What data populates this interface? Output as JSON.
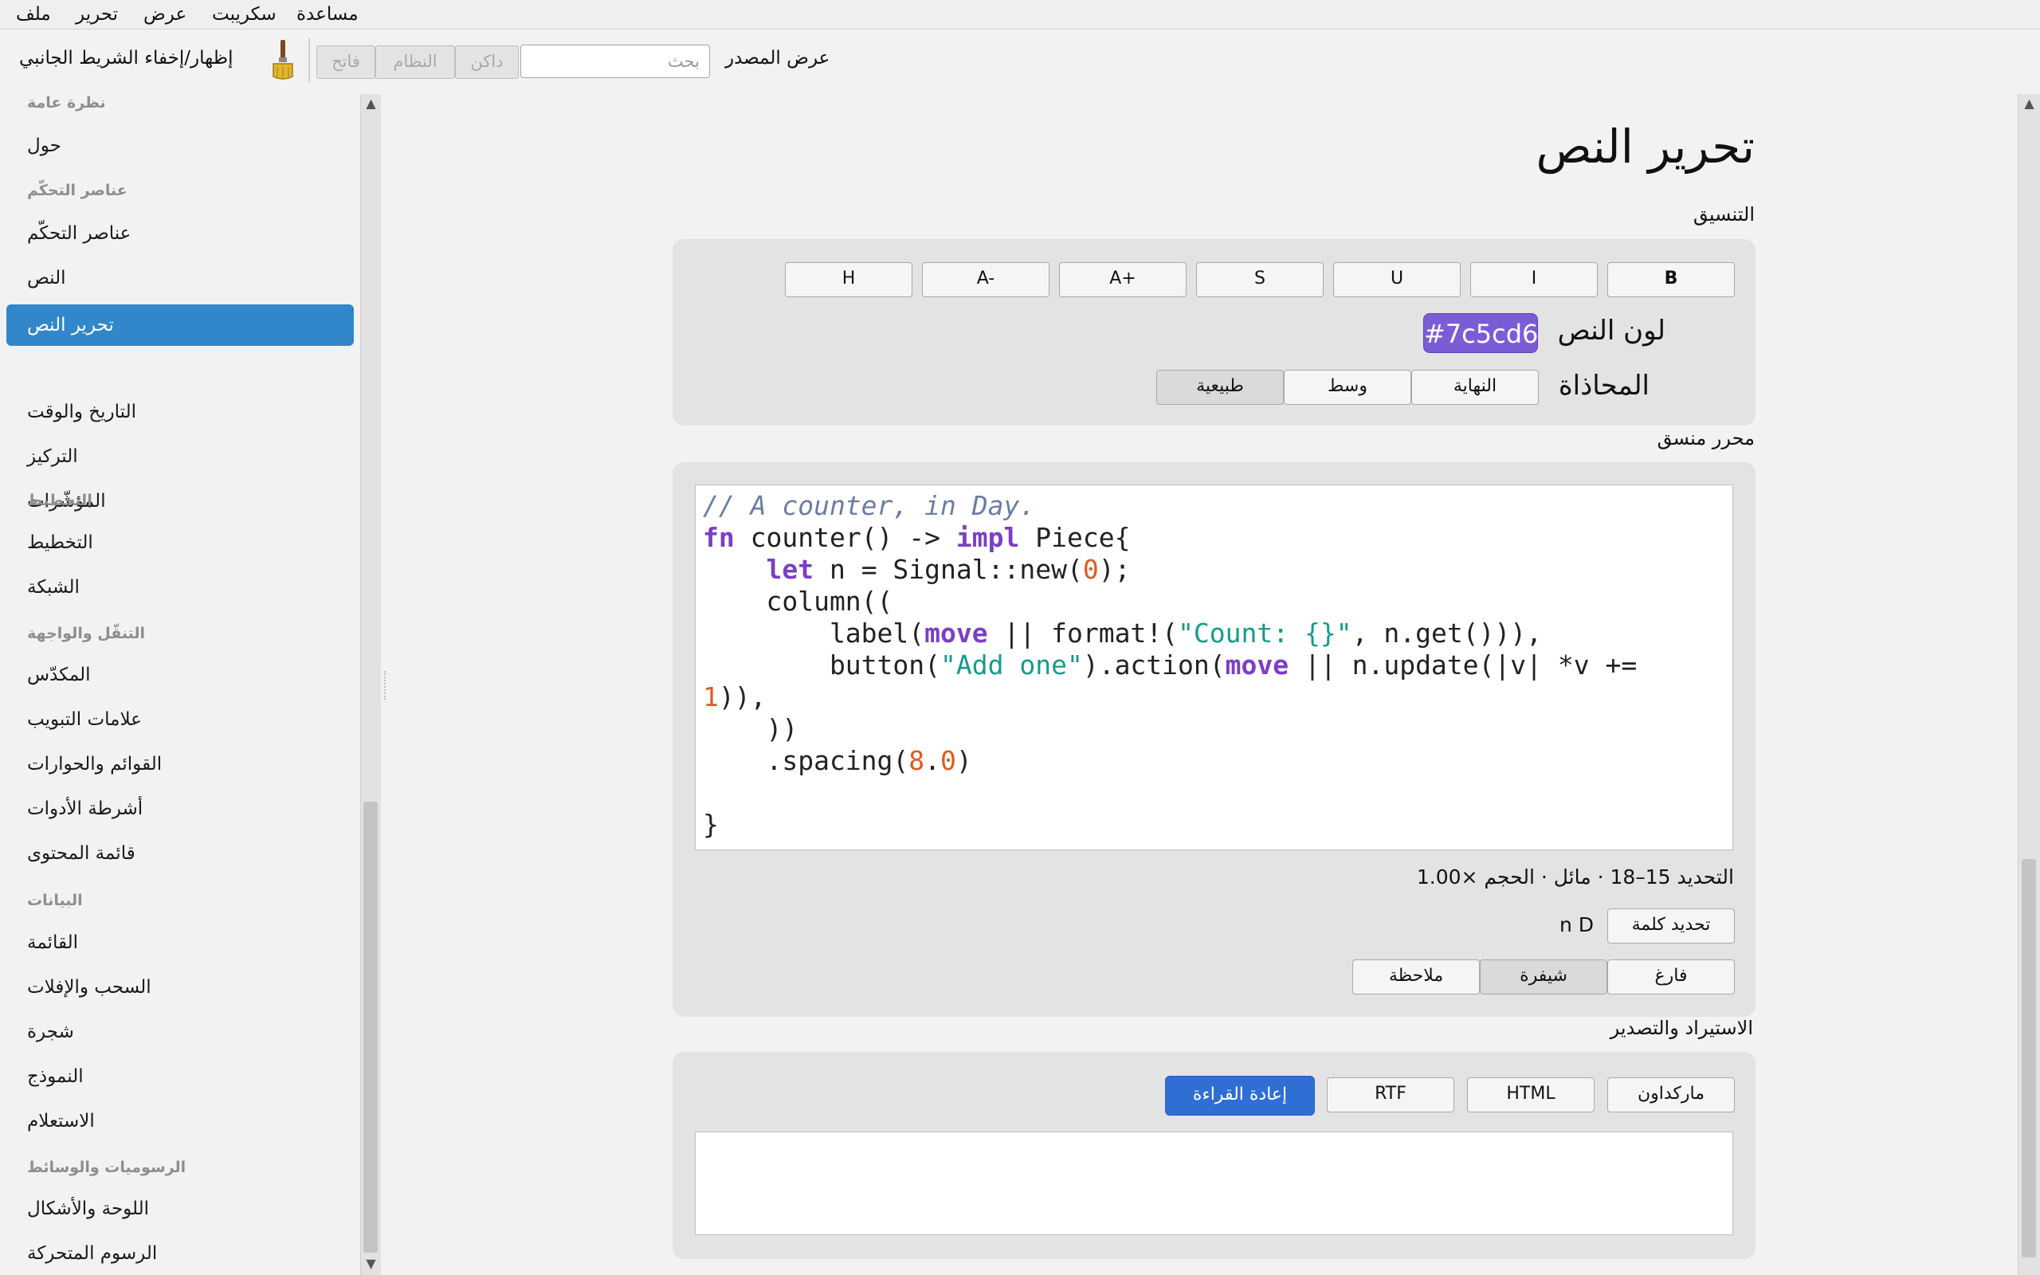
{
  "menu": [
    "ملف",
    "تحرير",
    "عرض",
    "سكريبت",
    "مساعدة"
  ],
  "toolbar": {
    "toggle_sidebar_label": "إظهار/إخفاء الشريط الجانبي",
    "theme_buttons": [
      "فاتح",
      "النظام",
      "داكن"
    ],
    "search_placeholder": "بحث",
    "view_source_label": "عرض المصدر"
  },
  "sidebar": {
    "sections": [
      {
        "heading": "نظرة عامة",
        "items": [
          "حول"
        ]
      },
      {
        "heading": "عناصر التحكّم",
        "items": [
          "عناصر التحكّم",
          "النص",
          "تحرير النص",
          "التاريخ والوقت",
          "التركيز",
          "المؤشّرات"
        ]
      },
      {
        "heading": "التخطيط",
        "items": [
          "التخطيط",
          "الشبكة"
        ]
      },
      {
        "heading": "التنقّل والواجهة",
        "items": [
          "المكدّس",
          "علامات التبويب",
          "القوائم والحوارات",
          "أشرطة الأدوات",
          "قائمة المحتوى"
        ]
      },
      {
        "heading": "البيانات",
        "items": [
          "القائمة",
          "السحب والإفلات",
          "شجرة",
          "النموذج",
          "الاستعلام"
        ]
      },
      {
        "heading": "الرسوميات والوسائط",
        "items": [
          "اللوحة والأشكال",
          "الرسوم المتحركة"
        ]
      }
    ],
    "active_item": "تحرير النص"
  },
  "page": {
    "title": "تحرير النص",
    "formatting": {
      "title": "التنسيق",
      "buttons": [
        "B",
        "I",
        "U",
        "S",
        "A+",
        "A-",
        "H"
      ],
      "text_color_label": "لون النص",
      "text_color_value": "#7c5cd6",
      "alignment_label": "المحاذاة",
      "alignment_options": [
        "النهاية",
        "وسط",
        "طبيعية"
      ],
      "alignment_selected": "طبيعية"
    },
    "rich_editor": {
      "title": "محرر منسق",
      "status": "التحديد 15–18 · مائل · الحجم ×1.00",
      "select_word_label": "تحديد كلمة",
      "selected_word": "n D",
      "mode_buttons": [
        "فارغ",
        "شيفرة",
        "ملاحظة"
      ],
      "mode_selected": "شيفرة"
    },
    "import_export": {
      "title": "الاستيراد والتصدير",
      "buttons": [
        "ماركداون",
        "HTML",
        "RTF"
      ],
      "reread_label": "إعادة القراءة"
    }
  },
  "colors": {
    "accent": "#3187c9",
    "text_color_swatch": "#7c5cd6",
    "primary_button": "#2f6fd4"
  },
  "icons": {
    "sidebar_toggle": "paintbrush-icon"
  }
}
